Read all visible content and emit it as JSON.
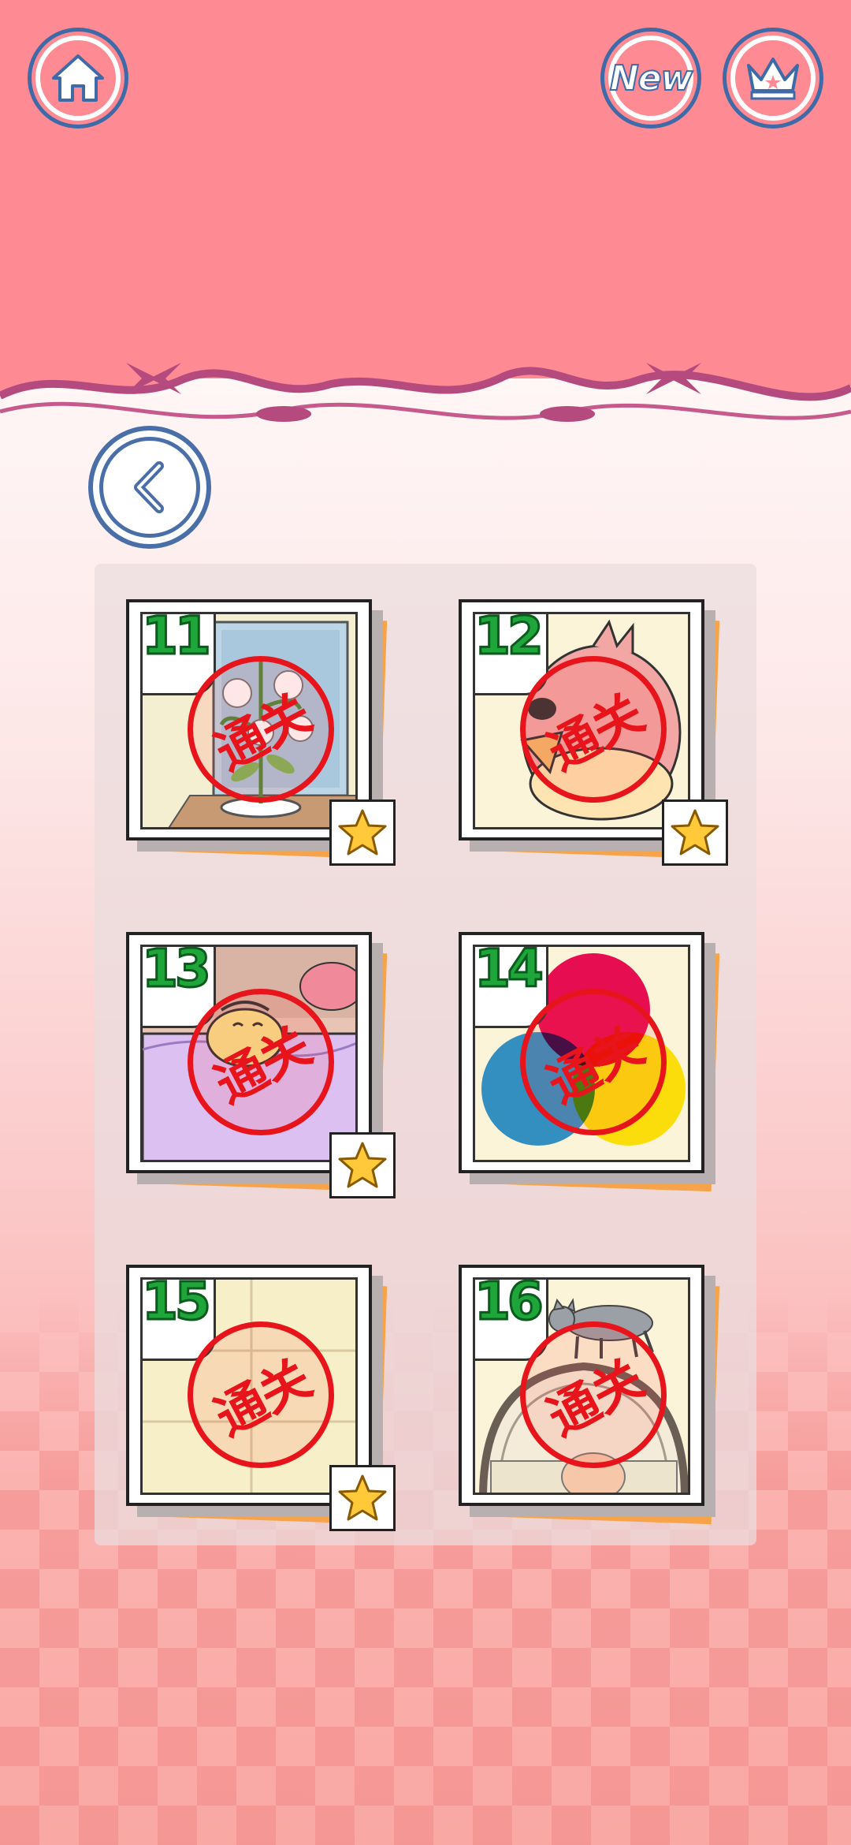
{
  "header": {
    "home_icon": "home-icon",
    "new_label": "New",
    "crown_icon": "crown-icon"
  },
  "back_icon": "chevron-left-icon",
  "levels": [
    {
      "number": "11",
      "stamp": "通关",
      "star": true,
      "scene": "lily-flowers"
    },
    {
      "number": "12",
      "stamp": "通关",
      "star": true,
      "scene": "bird"
    },
    {
      "number": "13",
      "stamp": "通关",
      "star": true,
      "scene": "bed"
    },
    {
      "number": "14",
      "stamp": "通关",
      "star": false,
      "scene": "color-circles"
    },
    {
      "number": "15",
      "stamp": "通关",
      "star": true,
      "scene": "blank-tiles"
    },
    {
      "number": "16",
      "stamp": "通关",
      "star": false,
      "scene": "cat-on-mirror"
    }
  ],
  "colors": {
    "header_pink": "#fe8a93",
    "button_blue": "#3e6aa8",
    "level_number_green": "#1fa63a",
    "stamp_red": "#e8141c",
    "star_gold": "#ffc93a",
    "paper_orange": "#f6a34a"
  }
}
